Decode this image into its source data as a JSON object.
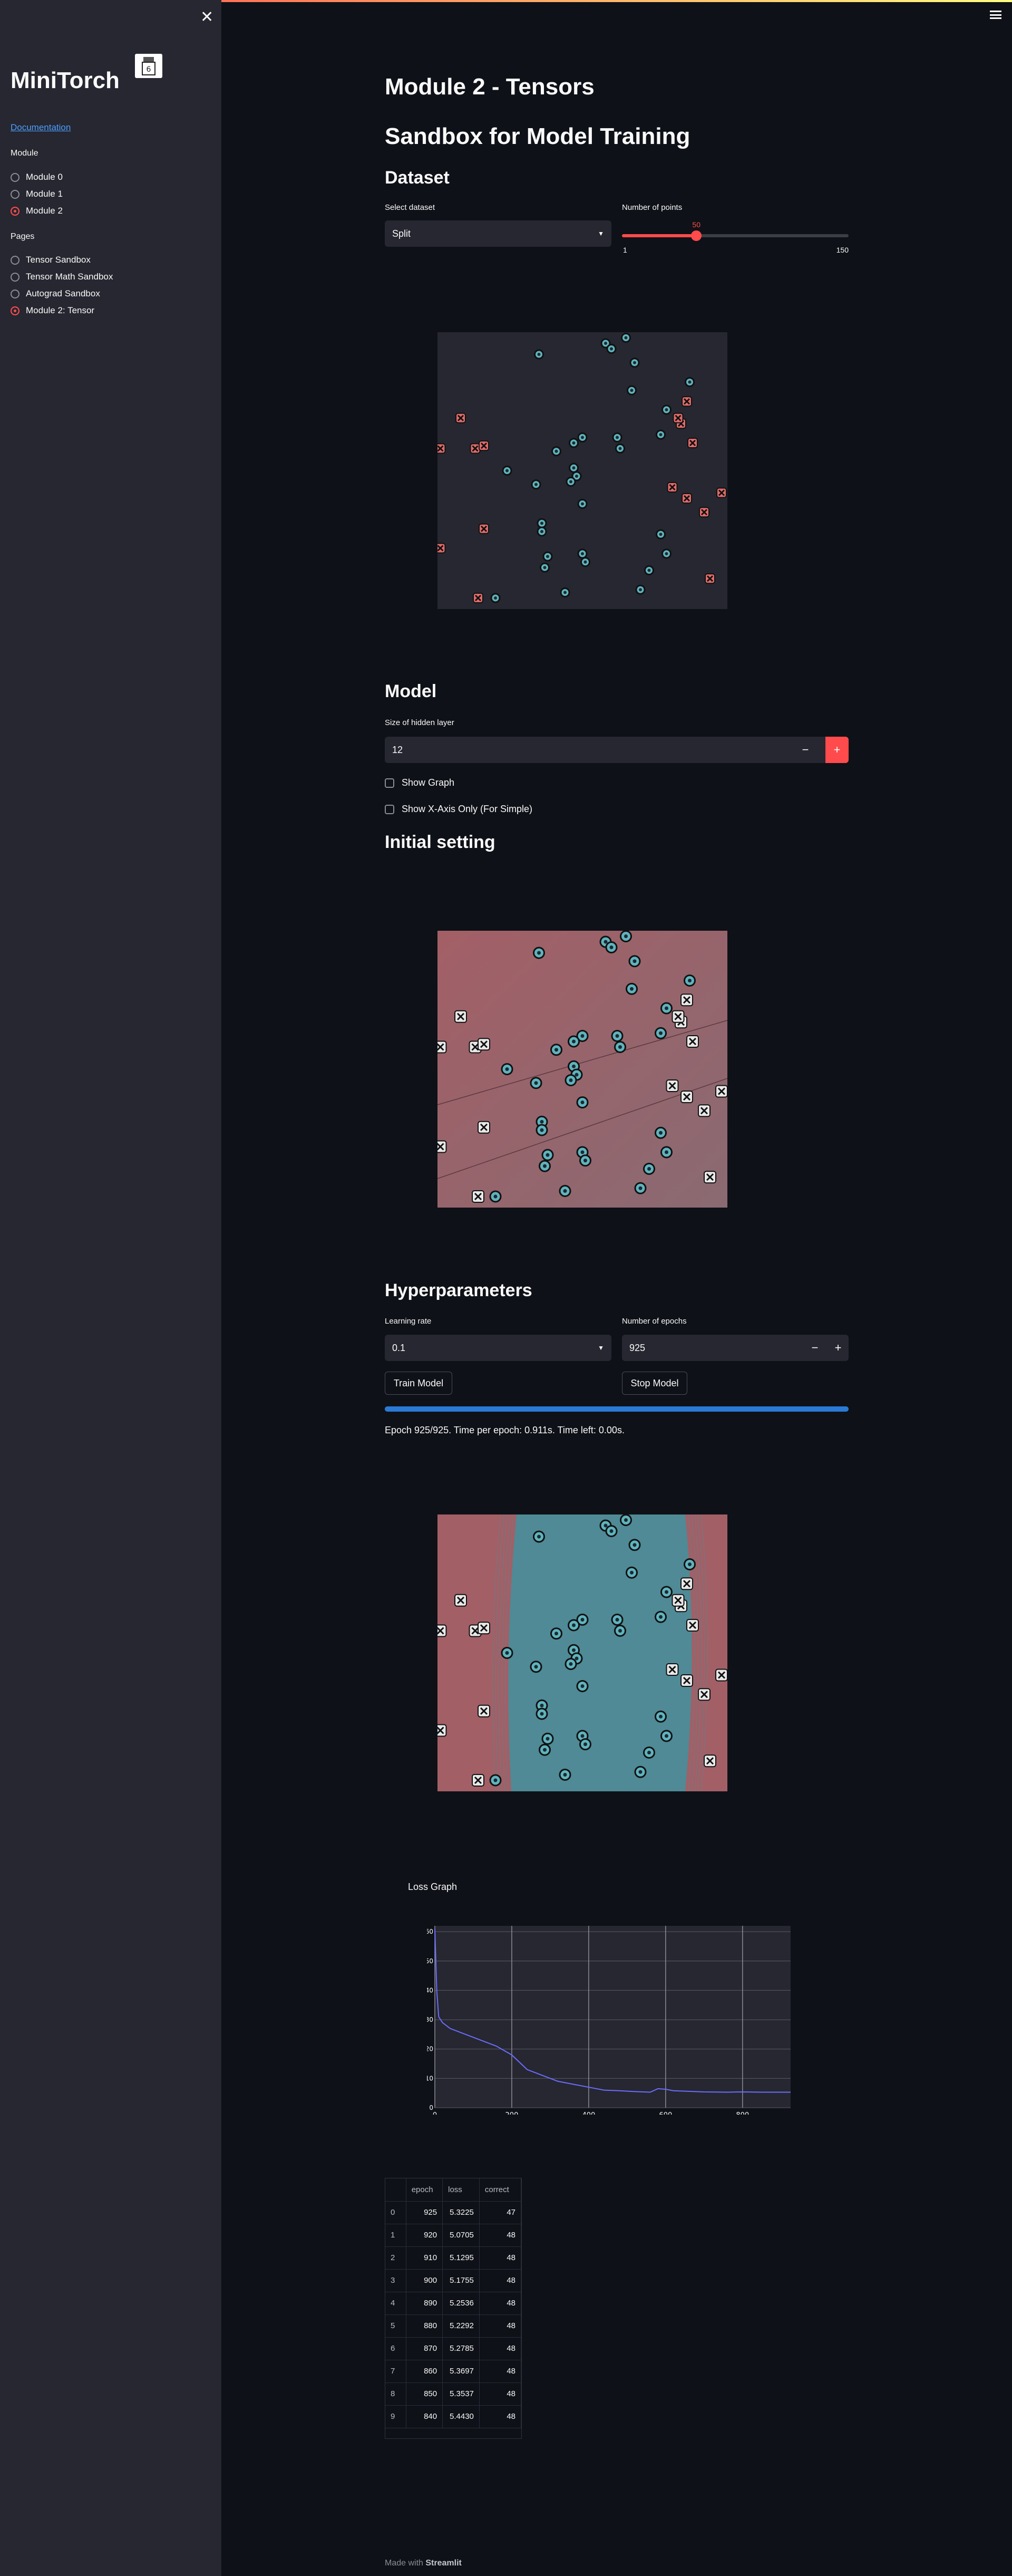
{
  "sidebar": {
    "title": "MiniTorch",
    "doc_link": "Documentation",
    "module_label": "Module",
    "modules": [
      {
        "label": "Module 0",
        "selected": false
      },
      {
        "label": "Module 1",
        "selected": false
      },
      {
        "label": "Module 2",
        "selected": true
      }
    ],
    "pages_label": "Pages",
    "pages": [
      {
        "label": "Tensor Sandbox",
        "selected": false
      },
      {
        "label": "Tensor Math Sandbox",
        "selected": false
      },
      {
        "label": "Autograd Sandbox",
        "selected": false
      },
      {
        "label": "Module 2: Tensor",
        "selected": true
      }
    ]
  },
  "main": {
    "title": "Module 2 - Tensors",
    "sandbox_title": "Sandbox for Model Training",
    "dataset": {
      "heading": "Dataset",
      "select_label": "Select dataset",
      "select_value": "Split",
      "points_label": "Number of points",
      "points_value": 50,
      "points_min": "1",
      "points_max": "150"
    },
    "model": {
      "heading": "Model",
      "hidden_label": "Size of hidden layer",
      "hidden_value": "12",
      "minus": "−",
      "plus": "+",
      "show_graph": "Show Graph",
      "show_x": "Show X-Axis Only (For Simple)"
    },
    "initial_heading": "Initial setting",
    "hyper": {
      "heading": "Hyperparameters",
      "lr_label": "Learning rate",
      "lr_value": "0.1",
      "epochs_label": "Number of epochs",
      "epochs_value": "925",
      "train_btn": "Train Model",
      "stop_btn": "Stop Model",
      "progress": 1.0,
      "status": "Epoch 925/925. Time per epoch: 0.911s. Time left: 0.00s."
    },
    "loss_graph_title": "Loss Graph",
    "table": {
      "columns": [
        "",
        "epoch",
        "loss",
        "correct"
      ],
      "rows": [
        [
          "0",
          "925",
          "5.3225",
          "47"
        ],
        [
          "1",
          "920",
          "5.0705",
          "48"
        ],
        [
          "2",
          "910",
          "5.1295",
          "48"
        ],
        [
          "3",
          "900",
          "5.1755",
          "48"
        ],
        [
          "4",
          "890",
          "5.2536",
          "48"
        ],
        [
          "5",
          "880",
          "5.2292",
          "48"
        ],
        [
          "6",
          "870",
          "5.2785",
          "48"
        ],
        [
          "7",
          "860",
          "5.3697",
          "48"
        ],
        [
          "8",
          "850",
          "5.3537",
          "48"
        ],
        [
          "9",
          "840",
          "5.4430",
          "48"
        ]
      ]
    },
    "footer_prefix": "Made with ",
    "footer_brand": "Streamlit"
  },
  "colors": {
    "accent": "#ff4b4b",
    "class_o": "#5fb3be",
    "class_x": "#e06b6b",
    "loss_line": "#6c6cff",
    "progress": "#2a7ad5"
  },
  "chart_data": [
    {
      "type": "scatter",
      "title": "",
      "xlim": [
        0,
        1
      ],
      "ylim": [
        0,
        1
      ],
      "series": [
        {
          "marker": "o",
          "points": [
            [
              0.35,
              0.92
            ],
            [
              0.58,
              0.96
            ],
            [
              0.6,
              0.94
            ],
            [
              0.65,
              0.98
            ],
            [
              0.68,
              0.89
            ],
            [
              0.67,
              0.79
            ],
            [
              0.79,
              0.72
            ],
            [
              0.77,
              0.63
            ],
            [
              0.87,
              0.82
            ],
            [
              0.5,
              0.62
            ],
            [
              0.41,
              0.57
            ],
            [
              0.47,
              0.6
            ],
            [
              0.63,
              0.58
            ],
            [
              0.62,
              0.62
            ],
            [
              0.24,
              0.5
            ],
            [
              0.34,
              0.45
            ],
            [
              0.47,
              0.51
            ],
            [
              0.48,
              0.48
            ],
            [
              0.5,
              0.38
            ],
            [
              0.46,
              0.46
            ],
            [
              0.36,
              0.31
            ],
            [
              0.36,
              0.28
            ],
            [
              0.38,
              0.19
            ],
            [
              0.5,
              0.2
            ],
            [
              0.51,
              0.17
            ],
            [
              0.37,
              0.15
            ],
            [
              0.77,
              0.27
            ],
            [
              0.79,
              0.2
            ],
            [
              0.73,
              0.14
            ],
            [
              0.7,
              0.07
            ],
            [
              0.44,
              0.06
            ],
            [
              0.2,
              0.04
            ]
          ]
        },
        {
          "marker": "x",
          "points": [
            [
              0.08,
              0.69
            ],
            [
              0.01,
              0.58
            ],
            [
              0.13,
              0.58
            ],
            [
              0.16,
              0.59
            ],
            [
              0.86,
              0.75
            ],
            [
              0.84,
              0.67
            ],
            [
              0.88,
              0.6
            ],
            [
              0.81,
              0.44
            ],
            [
              0.86,
              0.4
            ],
            [
              0.92,
              0.35
            ],
            [
              0.98,
              0.42
            ],
            [
              0.16,
              0.29
            ],
            [
              0.01,
              0.22
            ],
            [
              0.14,
              0.04
            ],
            [
              0.94,
              0.11
            ],
            [
              0.83,
              0.69
            ]
          ]
        }
      ]
    },
    {
      "type": "line",
      "title": "Loss Graph",
      "xlim": [
        0,
        925
      ],
      "ylim": [
        0,
        62
      ],
      "xticks": [
        0,
        200,
        400,
        600,
        800
      ],
      "yticks": [
        0,
        10,
        20,
        30,
        40,
        50,
        60
      ],
      "x": [
        0,
        5,
        10,
        20,
        40,
        80,
        120,
        160,
        200,
        240,
        280,
        320,
        360,
        400,
        440,
        480,
        520,
        560,
        580,
        600,
        620,
        660,
        700,
        760,
        800,
        850,
        925
      ],
      "y": [
        61,
        40,
        31,
        29,
        27,
        25,
        23,
        21,
        18,
        13,
        11,
        9,
        8,
        7,
        6,
        5.8,
        5.5,
        5.3,
        6.5,
        6.3,
        5.8,
        5.6,
        5.4,
        5.3,
        5.4,
        5.3,
        5.3
      ]
    }
  ]
}
